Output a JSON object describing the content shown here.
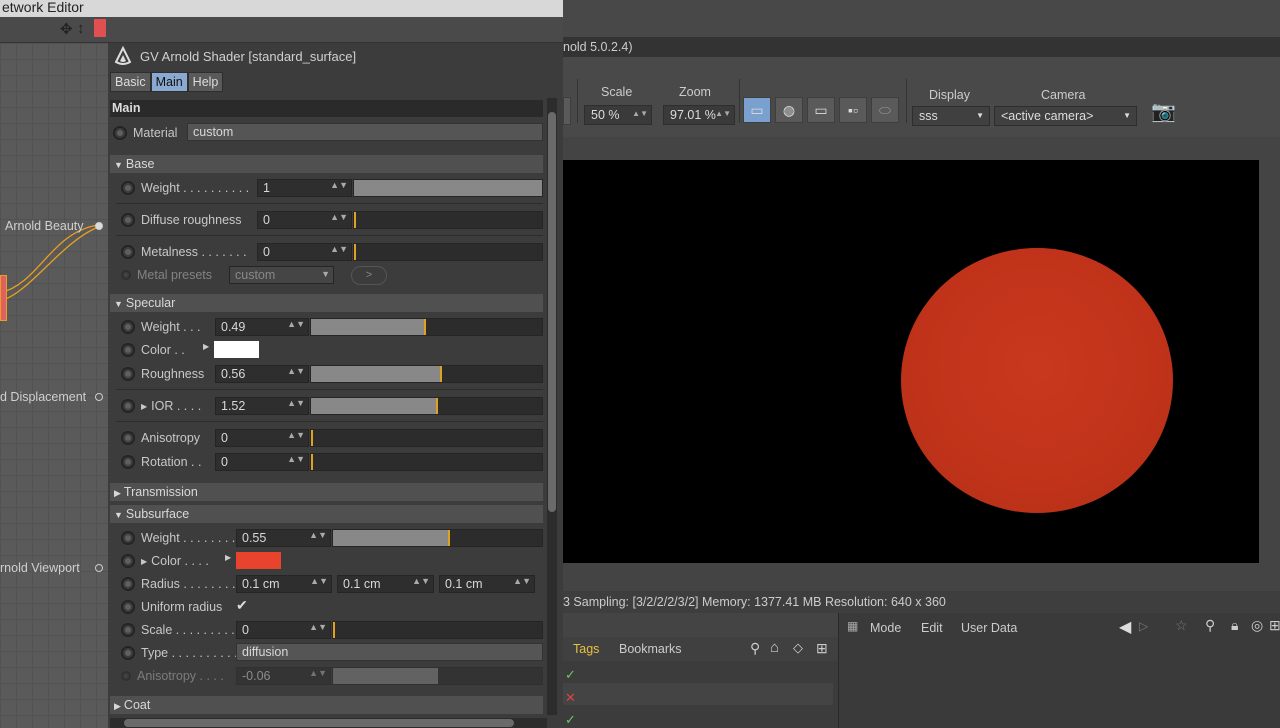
{
  "left_window": {
    "title": "etwork Editor",
    "node_labels": [
      "Arnold Beauty",
      "d Displacement",
      "rnold Viewport"
    ]
  },
  "shader": {
    "title": "GV Arnold Shader [standard_surface]",
    "tabs": [
      "Basic",
      "Main",
      "Help"
    ],
    "active_tab": "Main",
    "section_title": "Main",
    "material_label": "Material",
    "material_value": "custom",
    "base": {
      "title": "Base",
      "weight_label": "Weight . . . . . . . . . .",
      "weight_value": "1",
      "weight": 1.0,
      "diffuse_roughness_label": "Diffuse roughness",
      "diffuse_roughness_value": "0",
      "metalness_label": "Metalness . . . . . . .",
      "metalness_value": "0",
      "metal_presets_label": "Metal presets",
      "metal_presets_value": "custom",
      "metal_presets_button": ">"
    },
    "specular": {
      "title": "Specular",
      "weight_label": "Weight . . .",
      "weight_value": "0.49",
      "weight": 0.49,
      "color_label": "Color . .",
      "color": "#ffffff",
      "roughness_label": "Roughness",
      "roughness_value": "0.56",
      "roughness": 0.56,
      "ior_label": "IOR . . . .",
      "ior_value": "1.52",
      "anisotropy_label": "Anisotropy",
      "anisotropy_value": "0",
      "rotation_label": "Rotation . .",
      "rotation_value": "0"
    },
    "transmission": {
      "title": "Transmission"
    },
    "subsurface": {
      "title": "Subsurface",
      "weight_label": "Weight . . . . . . . .",
      "weight_value": "0.55",
      "weight": 0.55,
      "color_label": "Color . . . .",
      "color": "#e8432c",
      "radius_label": "Radius . . . . . . . .",
      "radius_values": [
        "0.1 cm",
        "0.1 cm",
        "0.1 cm"
      ],
      "uniform_radius_label": "Uniform radius",
      "uniform_radius_check": "✔",
      "scale_label": "Scale . . . . . . . . .",
      "scale_value": "0",
      "type_label": "Type . . . . . . . . . .",
      "type_value": "diffusion",
      "anisotropy_label": "Anisotropy . . . .",
      "anisotropy_value": "-0.06"
    },
    "coat": {
      "title": "Coat"
    }
  },
  "viewer": {
    "title_fragment": "nold 5.0.2.4)",
    "scale_label": "Scale",
    "scale_value": "50 %",
    "zoom_label": "Zoom",
    "zoom_value": "97.01 %",
    "display_label": "Display",
    "display_value": "sss",
    "camera_label": "Camera",
    "camera_value": "<active camera>",
    "status": "3   Sampling: [3/2/2/2/3/2]   Memory: 1377.41 MB   Resolution: 640 x 360",
    "sphere_color": "#c0331a"
  },
  "objects_panel": {
    "tabs": [
      "Tags",
      "Bookmarks"
    ]
  },
  "attributes_panel": {
    "menu": [
      "Mode",
      "Edit",
      "User Data"
    ]
  }
}
